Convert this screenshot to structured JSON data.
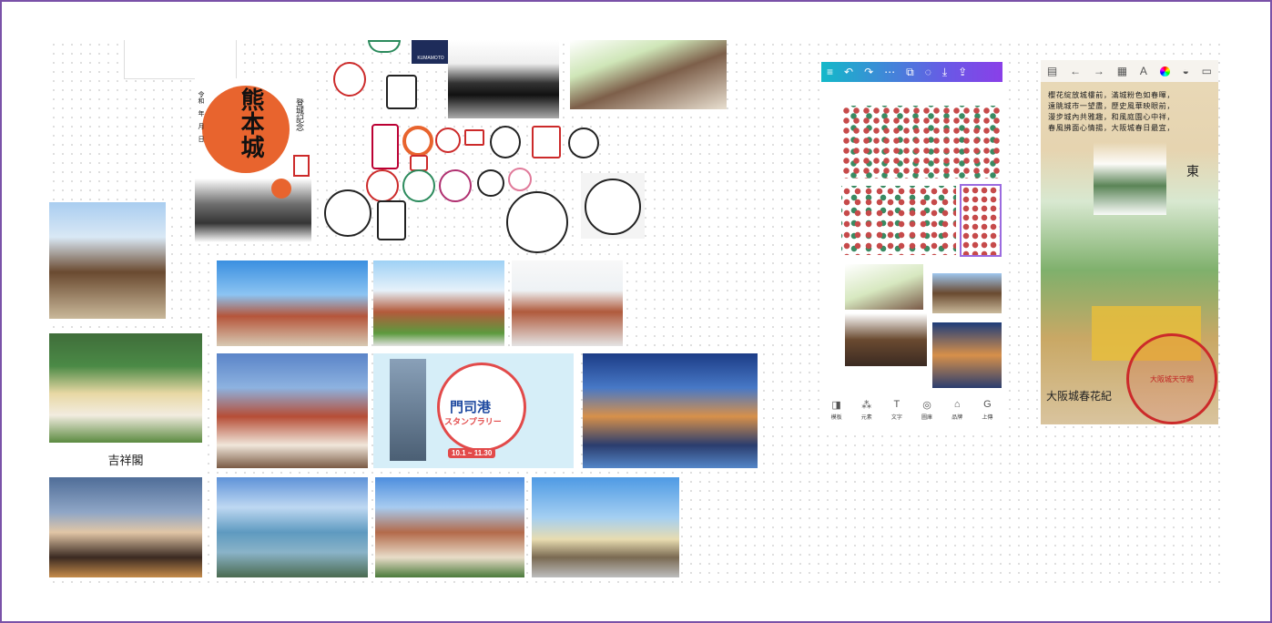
{
  "poster": {
    "title": "熊本城",
    "side_text": "登城記念",
    "left_text": "令和　年　月　日"
  },
  "logo": {
    "text": "KUMAMOTO"
  },
  "hotel": {
    "name": "吉祥閣"
  },
  "promo": {
    "title": "門司港",
    "subtitle": "スタンプラリー",
    "dates": "10.1 ~ 11.30"
  },
  "phone_app": {
    "toolbar_icons": [
      "menu-icon",
      "undo-icon",
      "redo-icon",
      "more-icon",
      "copy-icon",
      "comment-icon",
      "download-icon",
      "share-icon"
    ],
    "bottom_tools": [
      {
        "icon": "◨",
        "label": "模板"
      },
      {
        "icon": "⁂",
        "label": "元素"
      },
      {
        "icon": "T",
        "label": "文字"
      },
      {
        "icon": "◎",
        "label": "圖庫"
      },
      {
        "icon": "⌂",
        "label": "品牌"
      },
      {
        "icon": "G",
        "label": "上傳"
      }
    ]
  },
  "editor": {
    "toolbar_icons": [
      "layout-icon",
      "undo-icon",
      "redo-icon",
      "grid-icon",
      "text-icon",
      "color-icon",
      "layers-icon",
      "frame-icon"
    ],
    "poem_lines": [
      "櫻花綻放城樓前，滿城粉色如春暉，",
      "遠眺城市一望盡，歷史風華映眼前，",
      "漫步城內共雅趣，和風庭園心中祥，",
      "春風拂面心情揚，大阪城春日最宜，"
    ],
    "side_char": "東",
    "caption": "大阪城春花紀",
    "stamp_text": "大阪城天守閣"
  },
  "colors": {
    "frame": "#7a52a8",
    "accent_gradient_start": "#13b9c9",
    "accent_gradient_end": "#8a3fe8",
    "stamp_red": "#cc2a2a"
  }
}
